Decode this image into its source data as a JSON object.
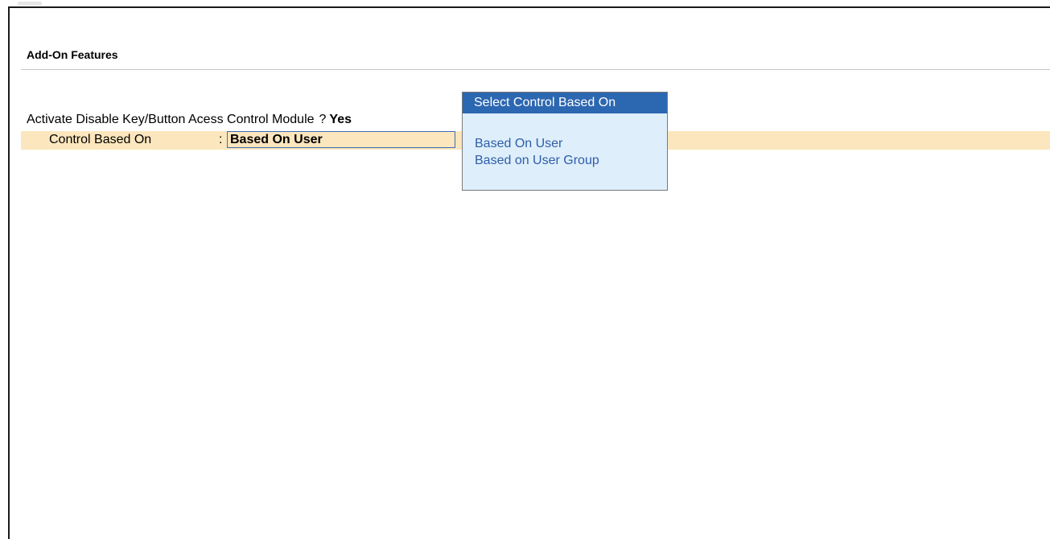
{
  "section": {
    "title": "Add-On Features"
  },
  "form": {
    "activate_label": "Activate Disable Key/Button Acess Control Module",
    "activate_question": "?",
    "activate_value": "Yes",
    "control_label": "Control Based On",
    "control_separator": ":",
    "control_value": "Based On User"
  },
  "popup": {
    "title": "Select Control Based On",
    "options": [
      {
        "label": "Based On User"
      },
      {
        "label": "Based on User Group"
      }
    ]
  },
  "colors": {
    "highlight_row": "#fce6bd",
    "popup_header": "#2c67b1",
    "popup_bg": "#deeefb",
    "popup_option_text": "#2e5ea8"
  }
}
